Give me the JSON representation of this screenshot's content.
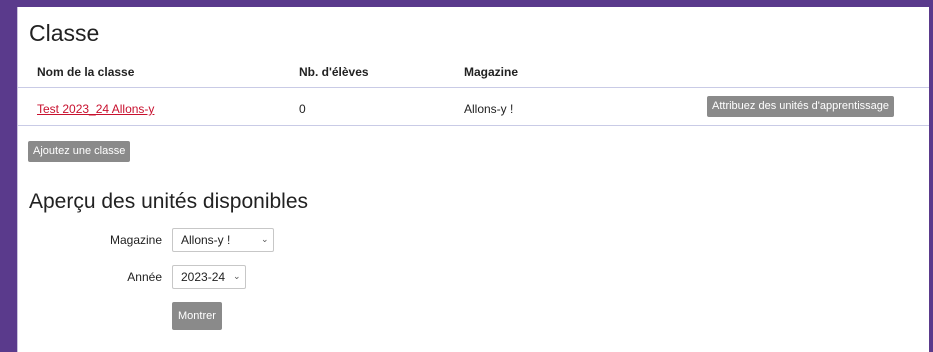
{
  "classes": {
    "title": "Classe",
    "headers": [
      "Nom de la classe",
      "Nb. d'élèves",
      "Magazine"
    ],
    "rows": [
      {
        "name": "Test 2023_24 Allons-y",
        "students": "0",
        "magazine": "Allons-y !",
        "action_label": "Attribuez des unités d'apprentissage"
      }
    ],
    "add_label": "Ajoutez une classe"
  },
  "units": {
    "title": "Aperçu des unités disponibles",
    "magazine_label": "Magazine",
    "magazine_value": "Allons-y !",
    "year_label": "Année",
    "year_value": "2023-24",
    "show_label": "Montrer"
  },
  "colors": {
    "background": "#5a3a8c",
    "link": "#c8102e",
    "button": "#8a8a8a"
  }
}
